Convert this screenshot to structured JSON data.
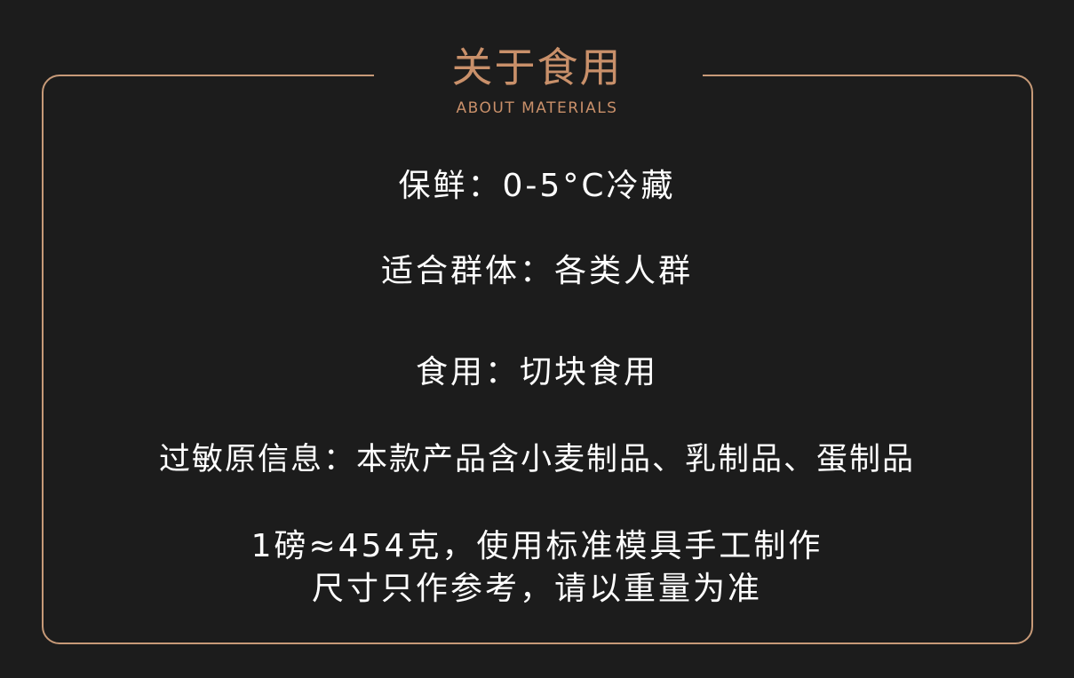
{
  "header": {
    "title": "关于食用",
    "subtitle": "ABOUT MATERIALS"
  },
  "info": {
    "storage": "保鲜：0-5°C冷藏",
    "audience": "适合群体：各类人群",
    "usage": "食用：切块食用",
    "allergen": "过敏原信息：本款产品含小麦制品、乳制品、蛋制品",
    "note_line1": "1磅≈454克，使用标准模具手工制作",
    "note_line2": "尺寸只作参考，请以重量为准"
  },
  "colors": {
    "background": "#1c1c1c",
    "accent": "#c9906a",
    "border": "#c79a78",
    "text": "#ffffff"
  }
}
